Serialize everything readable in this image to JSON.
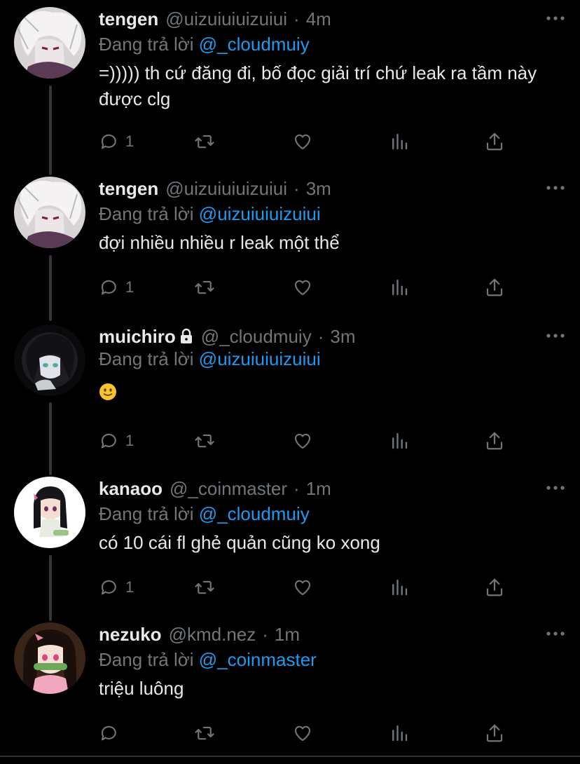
{
  "tweets": [
    {
      "name": "tengen",
      "handle": "@uizuiuiuizuiui",
      "time": "4m",
      "replying_prefix": "Đang trả lời",
      "replying_to": "@_cloudmuiy",
      "text": "=))))) th cứ đăng đi, bố đọc giải trí chứ leak ra tầm này được clg",
      "reply_count": "1",
      "locked": false
    },
    {
      "name": "tengen",
      "handle": "@uizuiuiuizuiui",
      "time": "3m",
      "replying_prefix": "Đang trả lời",
      "replying_to": "@uizuiuiuizuiui",
      "text": "đợi nhiều nhiều r leak một thể",
      "reply_count": "1",
      "locked": false
    },
    {
      "name": "muichiro",
      "handle": "@_cloudmuiy",
      "time": "3m",
      "replying_prefix": "Đang trả lời",
      "replying_to": "@uizuiuiuizuiui",
      "text": "",
      "emoji": "slightly-smiling-face",
      "reply_count": "1",
      "locked": true
    },
    {
      "name": "kanaoo",
      "handle": "@_coinmaster",
      "time": "1m",
      "replying_prefix": "Đang trả lời",
      "replying_to": "@_cloudmuiy",
      "text": "có 10 cái fl ghẻ quản cũng ko xong",
      "reply_count": "1",
      "locked": false
    },
    {
      "name": "nezuko",
      "handle": "@kmd.nez",
      "time": "1m",
      "replying_prefix": "Đang trả lời",
      "replying_to": "@_coinmaster",
      "text": "triệu luông",
      "reply_count": "",
      "locked": false
    }
  ],
  "icons": {
    "reply": "reply-icon",
    "retweet": "retweet-icon",
    "like": "heart-icon",
    "views": "analytics-icon",
    "share": "share-icon",
    "more": "more-icon",
    "lock": "lock-icon"
  },
  "colors": {
    "background": "#000000",
    "text": "#e7e9ea",
    "muted": "#71767b",
    "mention": "#1d9bf0"
  }
}
